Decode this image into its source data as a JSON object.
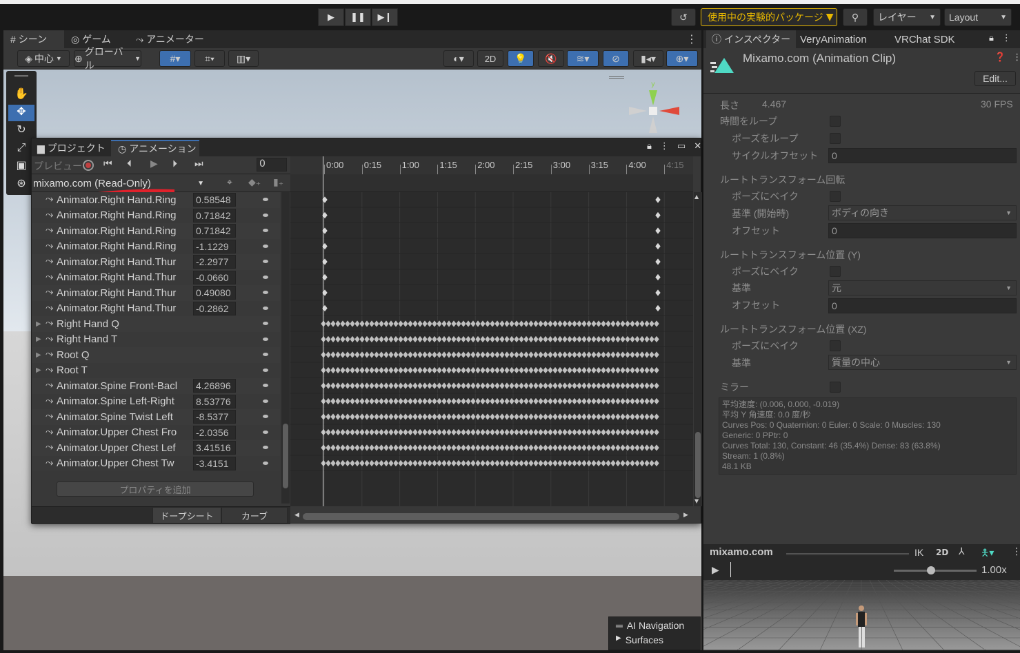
{
  "toolbar": {
    "experimental": "使用中の実験的パッケージ",
    "layers": "レイヤー",
    "layout": "Layout"
  },
  "scene_tabs": {
    "scene": "シーン",
    "game": "ゲーム",
    "animator": "アニメーター"
  },
  "scene_toolbar": {
    "pivot": "中心",
    "global": "グローバル",
    "mode_2d": "2D"
  },
  "inspector_tabs": {
    "inspector": "インスペクター",
    "very_animation": "VeryAnimation",
    "vrchat_sdk": "VRChat SDK"
  },
  "inspector": {
    "title": "Mixamo.com (Animation Clip)",
    "edit": "Edit...",
    "length_label": "長さ",
    "length_value": "4.467",
    "fps": "30 FPS",
    "loop_time": "時間をループ",
    "loop_pose": "ポーズをループ",
    "cycle_offset": "サイクルオフセット",
    "cycle_offset_value": "0",
    "root_rot": "ルートトランスフォーム回転",
    "bake_pose": "ポーズにベイク",
    "based_on_start": "基準 (開始時)",
    "body_orientation": "ボディの向き",
    "offset": "オフセット",
    "offset_value": "0",
    "root_pos_y": "ルートトランスフォーム位置 (Y)",
    "based_on": "基準",
    "original": "元",
    "root_pos_xz": "ルートトランスフォーム位置 (XZ)",
    "center_of_mass": "質量の中心",
    "mirror": "ミラー",
    "stats": [
      "平均速度: (0.006, 0.000, -0.019)",
      "平均 Y 角速度: 0.0 度/秒",
      "Curves Pos: 0 Quaternion: 0 Euler: 0 Scale: 0 Muscles: 130",
      "Generic: 0 PPtr: 0",
      "Curves Total: 130, Constant: 46 (35.4%) Dense: 83 (63.8%)",
      "Stream: 1 (0.8%)",
      "48.1 KB"
    ]
  },
  "preview": {
    "name": "mixamo.com",
    "ik": "IK",
    "mode_2d": "2D",
    "speed": "1.00x",
    "speed_fraction": 0.45
  },
  "anim": {
    "tabs": {
      "project": "プロジェクト",
      "animation": "アニメーション"
    },
    "preview": "プレビュー",
    "frame": "0",
    "clip": "mixamo.com (Read-Only)",
    "add_property": "プロパティを追加",
    "dopesheet": "ドープシート",
    "curves": "カーブ",
    "ruler": [
      "0:00",
      "0:15",
      "1:00",
      "1:15",
      "2:00",
      "2:15",
      "3:00",
      "3:15",
      "4:00",
      "4:15"
    ],
    "rows": [
      {
        "label": "Animator.Right Hand.Ring",
        "value": "0.58548",
        "group": false
      },
      {
        "label": "Animator.Right Hand.Ring",
        "value": "0.71842",
        "group": false
      },
      {
        "label": "Animator.Right Hand.Ring",
        "value": "0.71842",
        "group": false
      },
      {
        "label": "Animator.Right Hand.Ring",
        "value": "-1.1229",
        "group": false
      },
      {
        "label": "Animator.Right Hand.Thur",
        "value": "-2.2977",
        "group": false
      },
      {
        "label": "Animator.Right Hand.Thur",
        "value": "-0.0660",
        "group": false
      },
      {
        "label": "Animator.Right Hand.Thur",
        "value": "0.49080",
        "group": false
      },
      {
        "label": "Animator.Right Hand.Thur",
        "value": "-0.2862",
        "group": false
      },
      {
        "label": "Right Hand Q",
        "value": "",
        "group": true
      },
      {
        "label": "Right Hand T",
        "value": "",
        "group": true
      },
      {
        "label": "Root Q",
        "value": "",
        "group": true
      },
      {
        "label": "Root T",
        "value": "",
        "group": true
      },
      {
        "label": "Animator.Spine Front-Bacl",
        "value": "4.26896",
        "group": false
      },
      {
        "label": "Animator.Spine Left-Right",
        "value": "8.53776",
        "group": false
      },
      {
        "label": "Animator.Spine Twist Left",
        "value": "-8.5377",
        "group": false
      },
      {
        "label": "Animator.Upper Chest Fro",
        "value": "-2.0356",
        "group": false
      },
      {
        "label": "Animator.Upper Chest Lef",
        "value": "3.41516",
        "group": false
      },
      {
        "label": "Animator.Upper Chest Tw",
        "value": "-3.4151",
        "group": false
      }
    ]
  },
  "nav": {
    "title": "AI Navigation",
    "surfaces": "Surfaces"
  },
  "colors": {
    "accent": "#3d6fb0",
    "record": "#c04040",
    "warning": "#e8b800"
  }
}
